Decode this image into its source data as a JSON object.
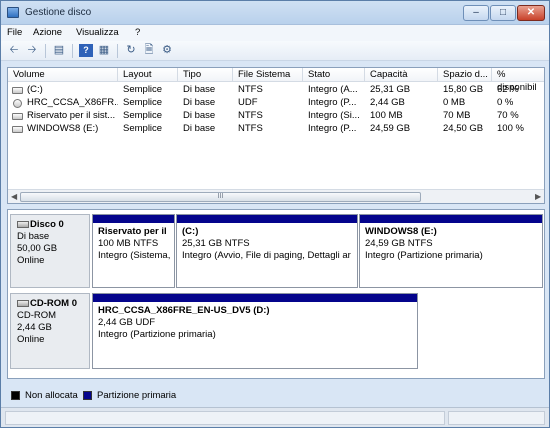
{
  "window": {
    "title": "Gestione disco"
  },
  "menu": [
    "File",
    "Azione",
    "Visualizza",
    "?"
  ],
  "toolbar": [
    "back-icon",
    "forward-icon",
    "show-hide-console-icon",
    "help-icon",
    "properties-icon",
    "refresh-icon",
    "export-icon",
    "disk-settings-icon"
  ],
  "volume_table": {
    "columns": [
      "Volume",
      "Layout",
      "Tipo",
      "File Sistema",
      "Stato",
      "Capacità",
      "Spazio d...",
      "% disponibil"
    ],
    "rows": [
      [
        "(C:)",
        "Semplice",
        "Di base",
        "NTFS",
        "Integro (A...",
        "25,31 GB",
        "15,80 GB",
        "62 %"
      ],
      [
        "HRC_CCSA_X86FR...",
        "Semplice",
        "Di base",
        "UDF",
        "Integro (P...",
        "2,44 GB",
        "0 MB",
        "0 %"
      ],
      [
        "Riservato per il sist...",
        "Semplice",
        "Di base",
        "NTFS",
        "Integro (Si...",
        "100 MB",
        "70 MB",
        "70 %"
      ],
      [
        "WINDOWS8 (E:)",
        "Semplice",
        "Di base",
        "NTFS",
        "Integro (P...",
        "24,59 GB",
        "24,50 GB",
        "100 %"
      ]
    ],
    "scroll_thumb": "III"
  },
  "disks": [
    {
      "name": "Disco 0",
      "type": "Di base",
      "size": "50,00 GB",
      "status": "Online",
      "partitions": [
        {
          "name": "Riservato per il",
          "info": "100 MB NTFS",
          "state": "Integro (Sistema,"
        },
        {
          "name": "(C:)",
          "info": "25,31 GB NTFS",
          "state": "Integro (Avvio, File di paging, Dettagli ar"
        },
        {
          "name": "WINDOWS8  (E:)",
          "info": "24,59 GB NTFS",
          "state": "Integro (Partizione primaria)"
        }
      ]
    },
    {
      "name": "CD-ROM 0",
      "type": "CD-ROM",
      "size": "2,44 GB",
      "status": "Online",
      "partitions": [
        {
          "name": "HRC_CCSA_X86FRE_EN-US_DV5  (D:)",
          "info": "2,44 GB UDF",
          "state": "Integro (Partizione primaria)"
        }
      ]
    }
  ],
  "legend": [
    {
      "label": "Non allocata",
      "color": "#000000"
    },
    {
      "label": "Partizione primaria",
      "color": "#04048c"
    }
  ]
}
